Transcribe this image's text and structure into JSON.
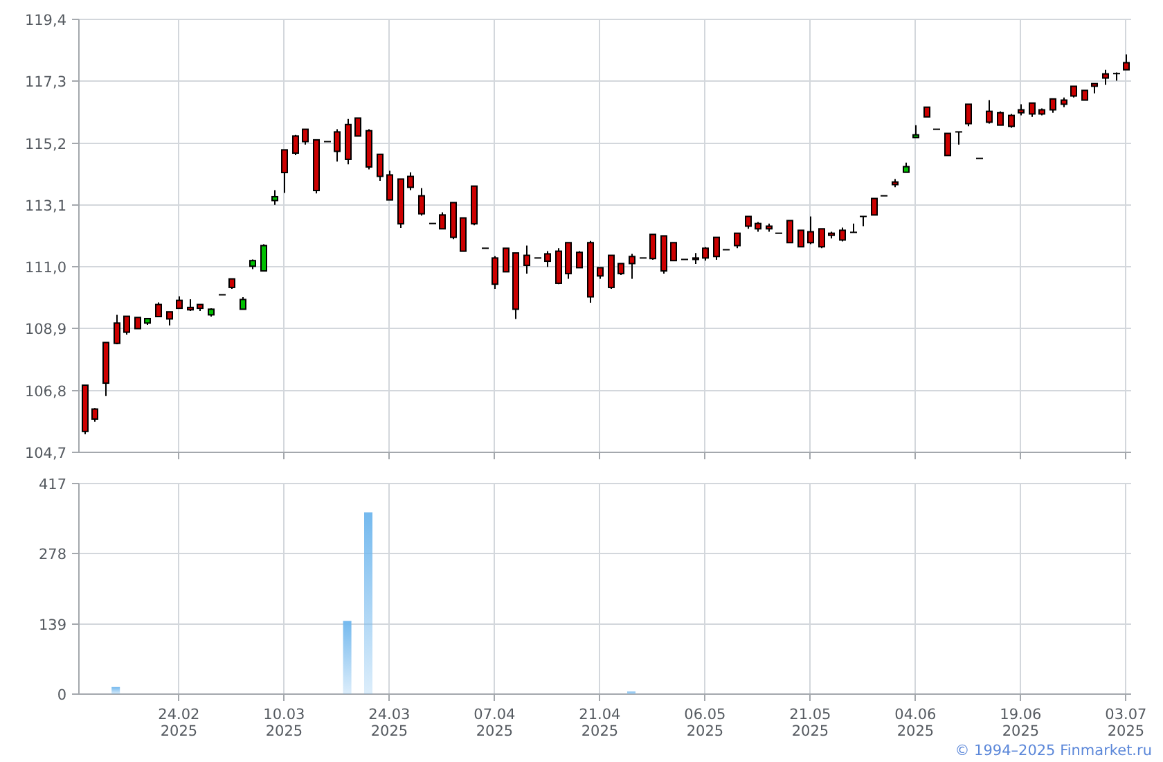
{
  "price_chart": {
    "chart_data": {
      "type": "candlestick",
      "grid": true,
      "categories": [
        null,
        null,
        null,
        null,
        null,
        null,
        null,
        null,
        null,
        null,
        null,
        null,
        null,
        null,
        null,
        null,
        null,
        null,
        null,
        null,
        null,
        null,
        null,
        null,
        null,
        null,
        null,
        null,
        null,
        null,
        null,
        null,
        null,
        null,
        null,
        null,
        null,
        null,
        null,
        null,
        null,
        null,
        null,
        null,
        null,
        null,
        null,
        null,
        null,
        null,
        null,
        null,
        null,
        null,
        null,
        null,
        null,
        null,
        null,
        null,
        null,
        null,
        null,
        null,
        null,
        null,
        null,
        null,
        null,
        null,
        null,
        null,
        null,
        null,
        null,
        null,
        null,
        null,
        null,
        null,
        null,
        null,
        null,
        null,
        null,
        null,
        null,
        null,
        null,
        null,
        null,
        null,
        null,
        null,
        null,
        null,
        null,
        null,
        null,
        null
      ],
      "ylim": [
        104.7,
        119.4
      ],
      "yticks": [
        {
          "value": 104.7,
          "label": "104,7"
        },
        {
          "value": 106.8,
          "label": "106,8"
        },
        {
          "value": 108.9,
          "label": "108,9"
        },
        {
          "value": 111.0,
          "label": "111,0"
        },
        {
          "value": 113.1,
          "label": "113,1"
        },
        {
          "value": 115.2,
          "label": "115,2"
        },
        {
          "value": 117.3,
          "label": "117,3"
        },
        {
          "value": 119.4,
          "label": "119,4"
        }
      ],
      "ohlc": [
        [
          106.98,
          106.98,
          105.32,
          105.41
        ],
        [
          106.17,
          106.2,
          105.74,
          105.83
        ],
        [
          108.43,
          108.43,
          106.61,
          107.05
        ],
        [
          109.09,
          109.37,
          108.37,
          108.4
        ],
        [
          109.32,
          109.32,
          108.7,
          108.78
        ],
        [
          109.28,
          109.28,
          108.9,
          108.9
        ],
        [
          109.09,
          109.24,
          109.03,
          109.24
        ],
        [
          109.72,
          109.79,
          109.31,
          109.31
        ],
        [
          109.47,
          109.47,
          109.01,
          109.23
        ],
        [
          109.86,
          110.0,
          109.59,
          109.59
        ],
        [
          109.62,
          109.9,
          109.5,
          109.54
        ],
        [
          109.72,
          109.72,
          109.5,
          109.59
        ],
        [
          109.37,
          109.59,
          109.31,
          109.56
        ],
        [
          110.05,
          110.05,
          110.05,
          110.05
        ],
        [
          110.59,
          110.59,
          110.25,
          110.3
        ],
        [
          109.56,
          109.97,
          109.56,
          109.89
        ],
        [
          111.02,
          111.25,
          110.92,
          111.21
        ],
        [
          110.86,
          111.77,
          110.86,
          111.72
        ],
        [
          113.25,
          113.6,
          113.1,
          113.38
        ],
        [
          114.97,
          114.97,
          113.51,
          114.2
        ],
        [
          115.44,
          115.48,
          114.79,
          114.86
        ],
        [
          115.67,
          115.67,
          115.15,
          115.25
        ],
        [
          115.31,
          115.31,
          113.49,
          113.59
        ],
        [
          115.25,
          115.25,
          115.25,
          115.25
        ],
        [
          115.58,
          115.67,
          114.57,
          114.92
        ],
        [
          115.83,
          116.02,
          114.48,
          114.65
        ],
        [
          116.05,
          116.05,
          115.44,
          115.44
        ],
        [
          115.62,
          115.67,
          114.31,
          114.39
        ],
        [
          114.82,
          114.82,
          113.92,
          114.07
        ],
        [
          114.12,
          114.26,
          113.27,
          113.27
        ],
        [
          113.98,
          113.98,
          112.32,
          112.46
        ],
        [
          114.07,
          114.21,
          113.6,
          113.7
        ],
        [
          113.41,
          113.67,
          112.74,
          112.8
        ],
        [
          112.47,
          112.47,
          112.47,
          112.47
        ],
        [
          112.76,
          112.85,
          112.29,
          112.29
        ],
        [
          113.18,
          113.18,
          111.94,
          112.0
        ],
        [
          112.66,
          112.66,
          111.53,
          111.53
        ],
        [
          113.74,
          113.74,
          112.41,
          112.46
        ],
        [
          111.63,
          111.63,
          111.63,
          111.63
        ],
        [
          111.3,
          111.36,
          110.25,
          110.41
        ],
        [
          111.63,
          111.63,
          110.83,
          110.83
        ],
        [
          111.47,
          111.47,
          109.23,
          109.56
        ],
        [
          111.39,
          111.72,
          110.77,
          111.05
        ],
        [
          111.3,
          111.3,
          111.3,
          111.3
        ],
        [
          111.44,
          111.53,
          111.0,
          111.19
        ],
        [
          111.53,
          111.63,
          110.41,
          110.44
        ],
        [
          111.82,
          111.82,
          110.59,
          110.77
        ],
        [
          111.49,
          111.53,
          110.97,
          110.97
        ],
        [
          111.82,
          111.88,
          109.78,
          109.98
        ],
        [
          110.97,
          110.97,
          110.59,
          110.69
        ],
        [
          111.39,
          111.39,
          110.25,
          110.3
        ],
        [
          111.11,
          111.11,
          110.72,
          110.77
        ],
        [
          111.35,
          111.44,
          110.59,
          111.11
        ],
        [
          111.3,
          111.3,
          111.3,
          111.3
        ],
        [
          112.1,
          112.1,
          111.24,
          111.28
        ],
        [
          112.05,
          112.05,
          110.77,
          110.86
        ],
        [
          111.82,
          111.82,
          111.21,
          111.21
        ],
        [
          111.25,
          111.25,
          111.25,
          111.25
        ],
        [
          111.3,
          111.47,
          111.1,
          111.25
        ],
        [
          111.63,
          111.67,
          111.21,
          111.3
        ],
        [
          112.0,
          112.0,
          111.24,
          111.35
        ],
        [
          111.58,
          111.58,
          111.58,
          111.58
        ],
        [
          112.14,
          112.14,
          111.63,
          111.72
        ],
        [
          112.71,
          112.71,
          112.29,
          112.38
        ],
        [
          112.47,
          112.52,
          112.19,
          112.29
        ],
        [
          112.38,
          112.47,
          112.19,
          112.29
        ],
        [
          112.14,
          112.14,
          112.14,
          112.14
        ],
        [
          112.57,
          112.57,
          111.82,
          111.82
        ],
        [
          112.24,
          112.24,
          111.68,
          111.68
        ],
        [
          112.19,
          112.71,
          111.77,
          111.82
        ],
        [
          112.29,
          112.29,
          111.63,
          111.68
        ],
        [
          112.14,
          112.19,
          111.96,
          112.07
        ],
        [
          112.24,
          112.33,
          111.86,
          111.91
        ],
        [
          112.17,
          112.47,
          112.16,
          112.16
        ],
        [
          112.71,
          112.71,
          112.38,
          112.7
        ],
        [
          113.32,
          113.32,
          112.76,
          112.76
        ],
        [
          113.41,
          113.41,
          113.41,
          113.41
        ],
        [
          113.88,
          113.98,
          113.7,
          113.79
        ],
        [
          114.21,
          114.54,
          114.21,
          114.4
        ],
        [
          115.39,
          115.81,
          115.39,
          115.48
        ],
        [
          116.42,
          116.42,
          116.09,
          116.09
        ],
        [
          115.67,
          115.67,
          115.67,
          115.67
        ],
        [
          115.53,
          115.53,
          114.78,
          114.78
        ],
        [
          115.58,
          115.58,
          115.15,
          115.57
        ],
        [
          116.52,
          116.52,
          115.77,
          115.86
        ],
        [
          114.68,
          114.68,
          114.68,
          114.68
        ],
        [
          116.28,
          116.66,
          115.86,
          115.91
        ],
        [
          116.23,
          116.28,
          115.81,
          115.81
        ],
        [
          116.14,
          116.19,
          115.72,
          115.77
        ],
        [
          116.33,
          116.52,
          116.14,
          116.23
        ],
        [
          116.56,
          116.56,
          116.09,
          116.19
        ],
        [
          116.33,
          116.38,
          116.14,
          116.19
        ],
        [
          116.7,
          116.7,
          116.23,
          116.33
        ],
        [
          116.66,
          116.75,
          116.42,
          116.52
        ],
        [
          117.13,
          117.13,
          116.75,
          116.8
        ],
        [
          116.99,
          116.99,
          116.66,
          116.66
        ],
        [
          117.22,
          117.22,
          116.89,
          117.13
        ],
        [
          117.55,
          117.69,
          117.18,
          117.41
        ],
        [
          117.56,
          117.6,
          117.32,
          117.55
        ],
        [
          117.93,
          118.21,
          117.69,
          117.69
        ]
      ]
    }
  },
  "volume_chart": {
    "chart_data": {
      "type": "bar",
      "grid": true,
      "categories": [
        null,
        null,
        null,
        null,
        null,
        null,
        null,
        null,
        null,
        "24.02\n2025",
        null,
        null,
        null,
        null,
        null,
        null,
        null,
        null,
        null,
        "10.03\n2025",
        null,
        null,
        null,
        null,
        null,
        null,
        null,
        null,
        null,
        "24.03\n2025",
        null,
        null,
        null,
        null,
        null,
        null,
        null,
        null,
        null,
        "07.04\n2025",
        null,
        null,
        null,
        null,
        null,
        null,
        null,
        null,
        null,
        "21.04\n2025",
        null,
        null,
        null,
        null,
        null,
        null,
        null,
        null,
        null,
        "06.05\n2025",
        null,
        null,
        null,
        null,
        null,
        null,
        null,
        null,
        null,
        "21.05\n2025",
        null,
        null,
        null,
        null,
        null,
        null,
        null,
        null,
        null,
        "04.06\n2025",
        null,
        null,
        null,
        null,
        null,
        null,
        null,
        null,
        null,
        "19.06\n2025",
        null,
        null,
        null,
        null,
        null,
        null,
        null,
        null,
        null,
        "03.07\n2025"
      ],
      "series": [
        {
          "name": null,
          "color": "#74b9ee",
          "values": [
            null,
            null,
            null,
            14,
            null,
            null,
            null,
            null,
            null,
            null,
            null,
            null,
            null,
            null,
            null,
            null,
            null,
            null,
            null,
            null,
            null,
            null,
            null,
            null,
            null,
            145,
            null,
            360,
            null,
            null,
            null,
            null,
            null,
            null,
            null,
            null,
            null,
            null,
            null,
            null,
            null,
            null,
            null,
            null,
            null,
            null,
            null,
            null,
            null,
            null,
            null,
            null,
            5,
            null,
            null,
            null,
            null,
            null,
            null,
            null,
            null,
            null,
            null,
            null,
            null,
            null,
            null,
            null,
            null,
            null,
            null,
            null,
            null,
            null,
            null,
            null,
            null,
            null,
            null,
            null,
            null,
            null,
            null,
            null,
            null,
            null,
            null,
            null,
            null,
            null,
            null,
            null,
            null,
            null,
            null,
            null,
            null,
            null,
            null,
            null
          ]
        }
      ],
      "ylim": [
        0,
        417
      ],
      "yticks": [
        0,
        139,
        278,
        417
      ]
    }
  },
  "copyright": "© 1994–2025 Finmarket.ru"
}
